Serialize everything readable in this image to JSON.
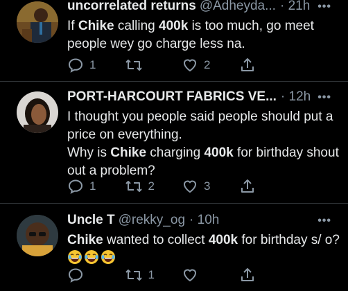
{
  "tweets": [
    {
      "name": "uncorrelated returns",
      "handle": "@Adheyda...",
      "time": "· 21h",
      "text": [
        {
          "t": "If "
        },
        {
          "b": "Chike"
        },
        {
          "t": " calling "
        },
        {
          "b": "400k"
        },
        {
          "t": " is too much, go meet people wey go charge less na."
        }
      ],
      "replies": "1",
      "retweets": "",
      "likes": "2"
    },
    {
      "name": "PORT-HARCOURT FABRICS VE...",
      "handle": "",
      "time": "· 12h",
      "text": [
        {
          "t": "I thought you people said people should put a price on everything."
        }
      ],
      "text2": [
        {
          "t": "Why is "
        },
        {
          "b": "Chike"
        },
        {
          "t": " charging "
        },
        {
          "b": "400k"
        },
        {
          "t": " for birthday shout out a problem?"
        }
      ],
      "replies": "1",
      "retweets": "2",
      "likes": "3"
    },
    {
      "name": "Uncle T",
      "handle": "@rekky_og",
      "time": "· 10h",
      "text": [
        {
          "b": "Chike"
        },
        {
          "t": " wanted to collect "
        },
        {
          "b": "400k"
        },
        {
          "t": " for birthday s/ o? "
        }
      ],
      "emojis": [
        "joy-emoji",
        "joy-emoji",
        "joy-emoji"
      ],
      "replies": "",
      "retweets": "1",
      "likes": ""
    }
  ],
  "icons": {
    "reply": "reply-icon",
    "retweet": "retweet-icon",
    "like": "heart-icon",
    "share": "share-icon",
    "more": "more-icon"
  },
  "colors": {
    "background": "#000000",
    "text": "#e7e9ea",
    "muted": "#8b98a5",
    "divider": "#2f3336"
  }
}
